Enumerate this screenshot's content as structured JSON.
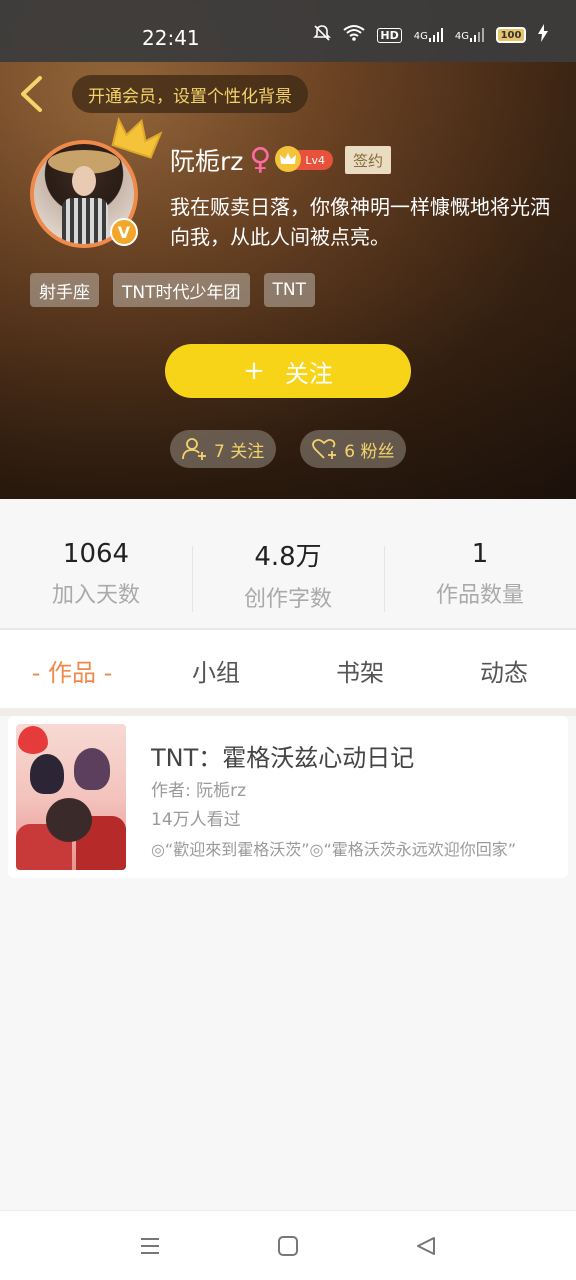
{
  "status_bar": {
    "time": "22:41",
    "battery": "100",
    "hd": "HD",
    "net1": "4G",
    "net2": "4G"
  },
  "header": {
    "vip_banner": "开通会员，设置个性化背景",
    "username": "阮栀rz",
    "gender_symbol": "♀",
    "level": "Lv4",
    "signed_label": "签约",
    "bio": "我在贩卖日落，你像神明一样慷慨地将光洒向我，从此人间被点亮。",
    "tags": [
      "射手座",
      "TNT时代少年团",
      "TNT"
    ],
    "follow_button": {
      "plus": "+",
      "label": "关注"
    },
    "following": "7 关注",
    "fans": "6 粉丝",
    "avatar_badge": "V"
  },
  "stats": [
    {
      "value": "1064",
      "label": "加入天数"
    },
    {
      "value": "4.8万",
      "label": "创作字数"
    },
    {
      "value": "1",
      "label": "作品数量"
    }
  ],
  "tabs": [
    {
      "label": "- 作品 -",
      "active": true
    },
    {
      "label": "小组",
      "active": false
    },
    {
      "label": "书架",
      "active": false
    },
    {
      "label": "动态",
      "active": false
    }
  ],
  "works": [
    {
      "title": "TNT：霍格沃兹心动日记",
      "author": "作者: 阮栀rz",
      "views": "14万人看过",
      "description": "◎“歡迎來到霍格沃茨”◎“霍格沃茨永远欢迎你回家”"
    }
  ],
  "colors": {
    "accent_orange": "#f08a4b",
    "follow_yellow": "#f8d419",
    "gold_text": "#f4d46a"
  }
}
